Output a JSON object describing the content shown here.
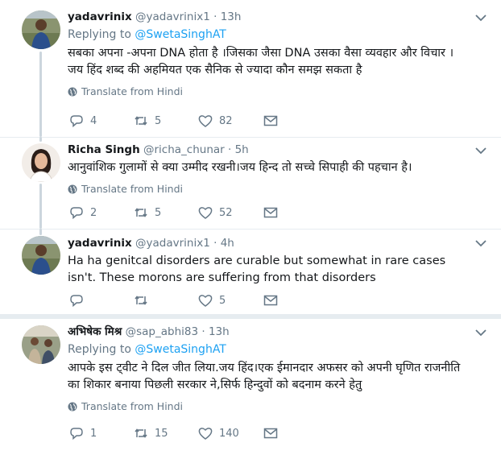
{
  "tweets": [
    {
      "name": "yadavrinix",
      "handle": "@yadavrinix1",
      "time": "13h",
      "replying_prefix": "Replying to ",
      "replying_to": "@SwetaSinghAT",
      "text": "सबका अपना -अपना DNA होता है ।जिसका जैसा DNA उसका वैसा व्यवहार और विचार । जय हिंद शब्द की  अहमियत  एक सैनिक से ज्यादा कौन समझ सकता है",
      "translate": "Translate from Hindi",
      "replies": "4",
      "retweets": "5",
      "likes": "82"
    },
    {
      "name": "Richa Singh",
      "handle": "@richa_chunar",
      "time": "5h",
      "text": "आनुवांशिक गुलामों से क्या उम्मीद रखनी।जय हिन्द तो सच्चे सिपाही की पहचान है।",
      "translate": "Translate from Hindi",
      "replies": "2",
      "retweets": "5",
      "likes": "52"
    },
    {
      "name": "yadavrinix",
      "handle": "@yadavrinix1",
      "time": "4h",
      "text": "Ha ha genitcal disorders are curable but somewhat in rare cases isn't. These morons are suffering from that disorders",
      "replies": "",
      "retweets": "",
      "likes": "5"
    },
    {
      "name": "अभिषेक मिश्र",
      "handle": "@sap_abhi83",
      "time": "13h",
      "replying_prefix": "Replying to ",
      "replying_to": "@SwetaSinghAT",
      "text": "आपके इस ट्वीट ने दिल जीत लिया.जय हिंद।एक ईमानदार अफसर को अपनी घृणित राजनीति का शिकार बनाया पिछली सरकार ने,सिर्फ हिन्दुवों को बदनाम करने हेतु",
      "translate": "Translate from Hindi",
      "replies": "1",
      "retweets": "15",
      "likes": "140"
    }
  ],
  "separator": "·",
  "colors": {
    "link": "#1da1f2",
    "muted": "#657786",
    "thread_line": "#ccd6dd"
  },
  "icons": [
    "reply-icon",
    "retweet-icon",
    "like-icon",
    "message-icon",
    "globe-icon",
    "chevron-down-icon"
  ]
}
